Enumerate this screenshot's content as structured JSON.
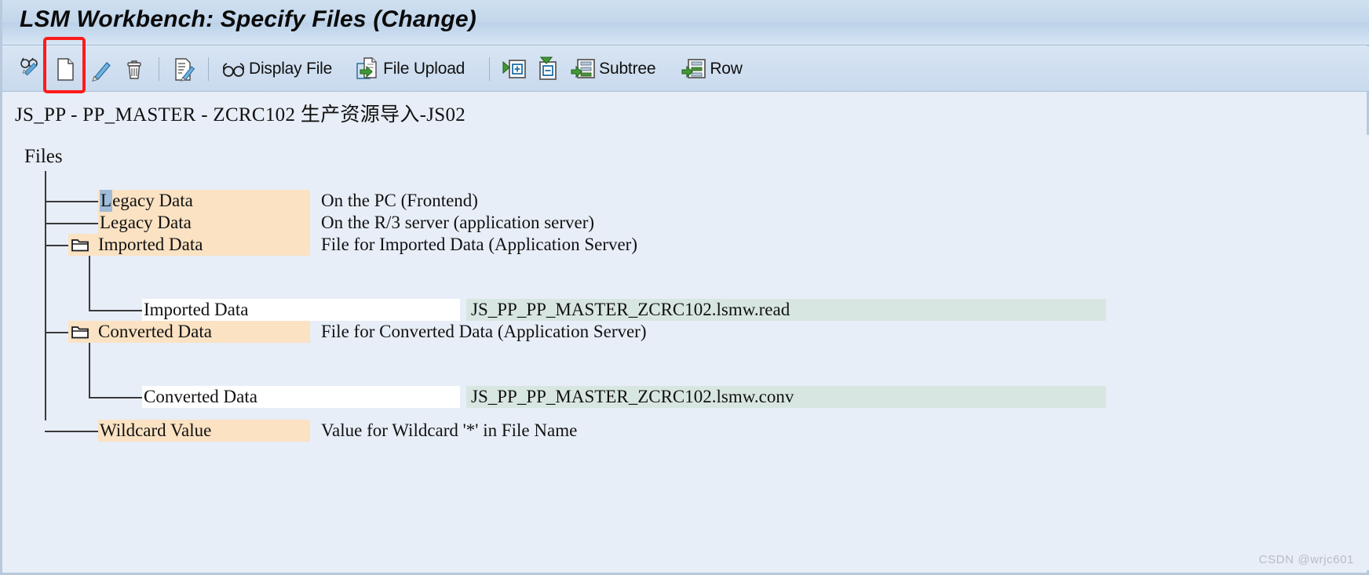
{
  "window": {
    "title": "LSM Workbench: Specify Files (Change)"
  },
  "toolbar": {
    "items": [
      {
        "icon": "glasses-pencil-icon",
        "label": ""
      },
      {
        "icon": "new-document-icon",
        "label": ""
      },
      {
        "icon": "pencil-icon",
        "label": ""
      },
      {
        "icon": "trash-icon",
        "label": ""
      },
      {
        "icon": "edit-document-icon",
        "label": ""
      },
      {
        "icon": "glasses-icon",
        "label": "Display File"
      },
      {
        "icon": "file-upload-icon",
        "label": "File Upload"
      },
      {
        "icon": "expand-node-icon",
        "label": ""
      },
      {
        "icon": "collapse-node-icon",
        "label": ""
      },
      {
        "icon": "subtree-icon",
        "label": "Subtree"
      },
      {
        "icon": "row-icon",
        "label": "Row"
      }
    ],
    "display_file_label": "Display File",
    "file_upload_label": "File Upload",
    "subtree_label": "Subtree",
    "row_label": "Row"
  },
  "breadcrumb": {
    "text": "JS_PP - PP_MASTER - ZCRC102 生产资源导入-JS02"
  },
  "tree": {
    "root_label": "Files",
    "rows": [
      {
        "name": "Legacy Data",
        "selected_char": "L",
        "rest": "egacy Data",
        "description": "On the PC (Frontend)",
        "value": "",
        "style": "tan",
        "icon": "none"
      },
      {
        "name": "Legacy Data",
        "description": "On the R/3 server (application server)",
        "value": "",
        "style": "tan",
        "icon": "none"
      },
      {
        "name": "Imported Data",
        "description": "File for Imported Data (Application Server)",
        "value": "",
        "style": "tan",
        "icon": "folder-icon"
      },
      {
        "name": "Imported Data",
        "description": "",
        "value": "JS_PP_PP_MASTER_ZCRC102.lsmw.read",
        "style": "white",
        "icon": "none"
      },
      {
        "name": "Converted Data",
        "description": "File for Converted Data (Application Server)",
        "value": "",
        "style": "tan",
        "icon": "folder-icon"
      },
      {
        "name": "Converted Data",
        "description": "",
        "value": "JS_PP_PP_MASTER_ZCRC102.lsmw.conv",
        "style": "white",
        "icon": "none"
      },
      {
        "name": "Wildcard Value",
        "description": "Value for Wildcard '*' in File Name",
        "value": "",
        "style": "tan",
        "icon": "none"
      }
    ]
  },
  "annotation": {
    "highlight_target": "new-document-icon",
    "highlight_color": "#fc1b1b"
  },
  "watermark": {
    "text": "CSDN @wrjc601"
  },
  "colors": {
    "title_bar": "#c3d7ec",
    "toolbar": "#cfdef0",
    "canvas": "#e8eef7",
    "node_tan": "#fae2c3",
    "node_white": "#ffffff",
    "value_green": "#d8e6e2",
    "selection_blue": "#9fbcd8"
  }
}
